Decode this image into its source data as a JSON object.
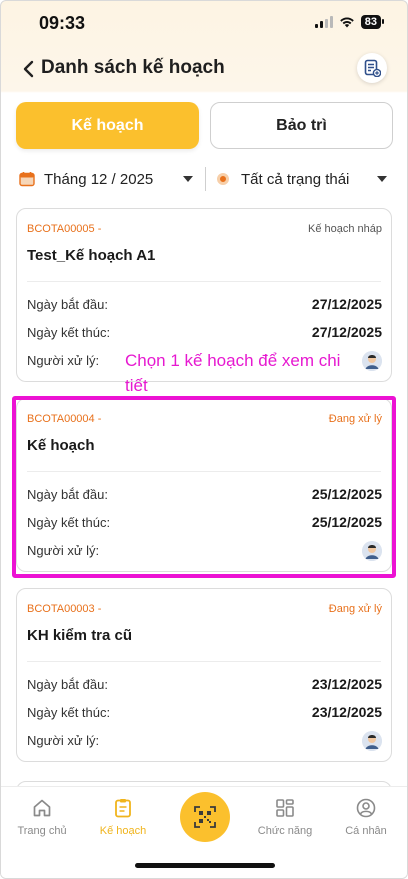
{
  "status_bar": {
    "time": "09:33",
    "battery": "83"
  },
  "header": {
    "title": "Danh sách kế hoạch"
  },
  "tabs": {
    "active_label": "Kế hoạch",
    "inactive_label": "Bảo trì"
  },
  "filters": {
    "month": "Tháng 12 / 2025",
    "status": "Tất cả trạng thái"
  },
  "labels": {
    "start_date": "Ngày bắt đầu:",
    "end_date": "Ngày kết thúc:",
    "handler": "Người xử lý:"
  },
  "plans": [
    {
      "code": "BCOTA00005 -",
      "status": "Kế hoạch nháp",
      "status_color": "#555555",
      "name": "Test_Kế hoạch A1",
      "start": "27/12/2025",
      "end": "27/12/2025"
    },
    {
      "code": "BCOTA00004 -",
      "status": "Đang xử lý",
      "status_color": "#e8711c",
      "name": "Kế hoạch",
      "start": "25/12/2025",
      "end": "25/12/2025"
    },
    {
      "code": "BCOTA00003 -",
      "status": "Đang xử lý",
      "status_color": "#e8711c",
      "name": "KH kiểm tra cũ",
      "start": "23/12/2025",
      "end": "23/12/2025"
    }
  ],
  "annotation": {
    "text": "Chọn 1 kế hoạch để xem chi tiết",
    "color": "#e619d0"
  },
  "bottom_nav": {
    "home": "Trang chủ",
    "plan": "Kế hoạch",
    "functions": "Chức năng",
    "profile": "Cá nhân"
  },
  "colors": {
    "accent": "#fbc02d",
    "orange": "#e8711c",
    "highlight": "#ec12d3"
  }
}
